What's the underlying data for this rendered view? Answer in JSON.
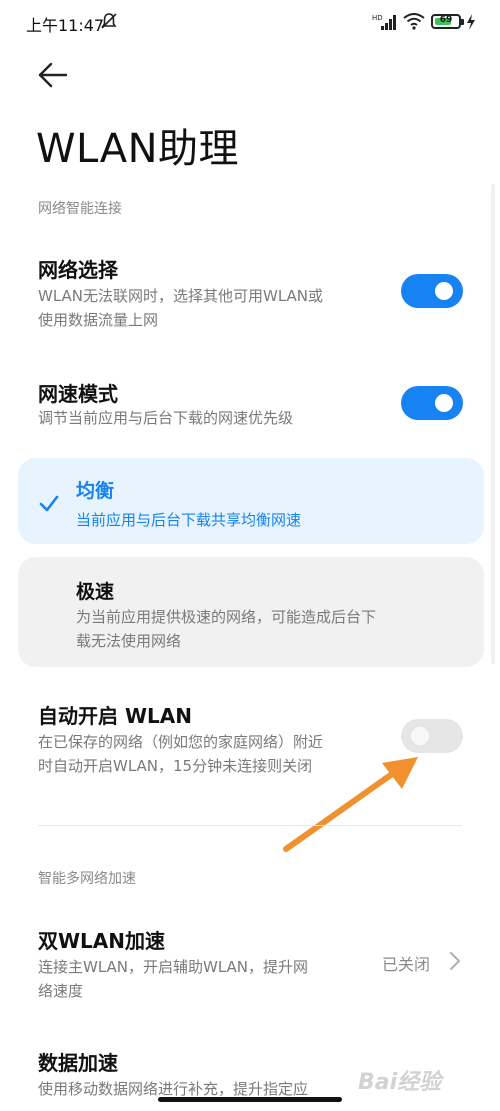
{
  "status_bar": {
    "time": "上午11:47",
    "battery": "69",
    "icons": [
      "notification-off-icon",
      "hd-signal-icon",
      "wifi-icon",
      "battery-icon",
      "charging-icon"
    ]
  },
  "header": {
    "title": "WLAN助理"
  },
  "sections": {
    "smart_connect": "网络智能连接",
    "multi_network": "智能多网络加速"
  },
  "network_select": {
    "title": "网络选择",
    "desc_line1": "WLAN无法联网时，选择其他可用WLAN或",
    "desc_line2": "使用数据流量上网",
    "enabled": true
  },
  "speed_mode": {
    "title": "网速模式",
    "desc": "调节当前应用与后台下载的网速优先级",
    "enabled": true
  },
  "mode_options": [
    {
      "title": "均衡",
      "desc": "当前应用与后台下载共享均衡网速",
      "selected": true
    },
    {
      "title": "极速",
      "desc_line1": "为当前应用提供极速的网络，可能造成后台下",
      "desc_line2": "载无法使用网络",
      "selected": false
    }
  ],
  "auto_wlan": {
    "title": "自动开启 WLAN",
    "desc_line1": "在已保存的网络（例如您的家庭网络）附近",
    "desc_line2": "时自动开启WLAN，15分钟未连接则关闭",
    "enabled": false
  },
  "dual_wlan": {
    "title": "双WLAN加速",
    "desc_line1": "连接主WLAN，开启辅助WLAN，提升网",
    "desc_line2": "络速度",
    "value": "已关闭"
  },
  "data_accel": {
    "title": "数据加速",
    "desc": "使用移动数据网络进行补充，提升指定应"
  },
  "watermark": "Bai经验",
  "colors": {
    "accent": "#1783f2",
    "selected_card": "#e7f3fd",
    "annotation_arrow": "#f0902e"
  }
}
